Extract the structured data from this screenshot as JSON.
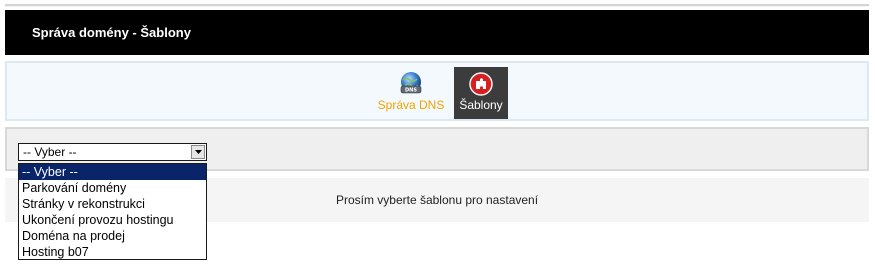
{
  "header": {
    "title": "Správa domény - Šablony"
  },
  "nav": {
    "items": [
      {
        "label": "Správa DNS",
        "icon": "dns-globe-icon"
      },
      {
        "label": "Šablony",
        "icon": "templates-icon",
        "active": true
      }
    ]
  },
  "form": {
    "select": {
      "value": "-- Vyber --",
      "options": [
        "-- Vyber --",
        "Parkování domény",
        "Stránky v rekonstrukci",
        "Ukončení provozu hostingu",
        "Doména na prodej",
        "Hosting b07"
      ]
    }
  },
  "message": "Prosím vyberte šablonu pro nastavení",
  "colors": {
    "header_bg": "#000000",
    "nav_bg": "#f4f9fd",
    "nav_link": "#f0a400",
    "nav_active_bg": "#3c3c3c",
    "selected_option_bg": "#0a246a"
  }
}
